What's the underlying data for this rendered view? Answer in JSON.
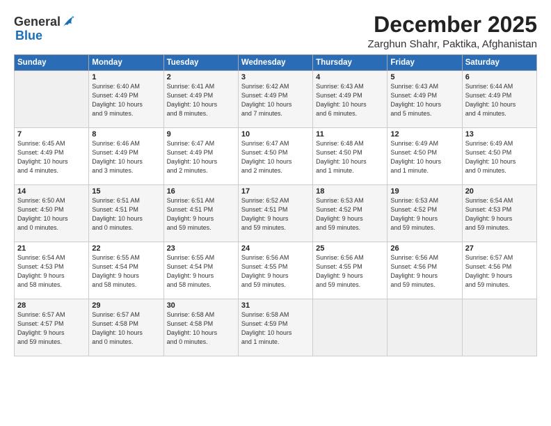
{
  "header": {
    "logo_general": "General",
    "logo_blue": "Blue",
    "title": "December 2025",
    "subtitle": "Zarghun Shahr, Paktika, Afghanistan"
  },
  "columns": [
    "Sunday",
    "Monday",
    "Tuesday",
    "Wednesday",
    "Thursday",
    "Friday",
    "Saturday"
  ],
  "rows": [
    [
      {
        "day": "",
        "info": ""
      },
      {
        "day": "1",
        "info": "Sunrise: 6:40 AM\nSunset: 4:49 PM\nDaylight: 10 hours\nand 9 minutes."
      },
      {
        "day": "2",
        "info": "Sunrise: 6:41 AM\nSunset: 4:49 PM\nDaylight: 10 hours\nand 8 minutes."
      },
      {
        "day": "3",
        "info": "Sunrise: 6:42 AM\nSunset: 4:49 PM\nDaylight: 10 hours\nand 7 minutes."
      },
      {
        "day": "4",
        "info": "Sunrise: 6:43 AM\nSunset: 4:49 PM\nDaylight: 10 hours\nand 6 minutes."
      },
      {
        "day": "5",
        "info": "Sunrise: 6:43 AM\nSunset: 4:49 PM\nDaylight: 10 hours\nand 5 minutes."
      },
      {
        "day": "6",
        "info": "Sunrise: 6:44 AM\nSunset: 4:49 PM\nDaylight: 10 hours\nand 4 minutes."
      }
    ],
    [
      {
        "day": "7",
        "info": "Sunrise: 6:45 AM\nSunset: 4:49 PM\nDaylight: 10 hours\nand 4 minutes."
      },
      {
        "day": "8",
        "info": "Sunrise: 6:46 AM\nSunset: 4:49 PM\nDaylight: 10 hours\nand 3 minutes."
      },
      {
        "day": "9",
        "info": "Sunrise: 6:47 AM\nSunset: 4:49 PM\nDaylight: 10 hours\nand 2 minutes."
      },
      {
        "day": "10",
        "info": "Sunrise: 6:47 AM\nSunset: 4:50 PM\nDaylight: 10 hours\nand 2 minutes."
      },
      {
        "day": "11",
        "info": "Sunrise: 6:48 AM\nSunset: 4:50 PM\nDaylight: 10 hours\nand 1 minute."
      },
      {
        "day": "12",
        "info": "Sunrise: 6:49 AM\nSunset: 4:50 PM\nDaylight: 10 hours\nand 1 minute."
      },
      {
        "day": "13",
        "info": "Sunrise: 6:49 AM\nSunset: 4:50 PM\nDaylight: 10 hours\nand 0 minutes."
      }
    ],
    [
      {
        "day": "14",
        "info": "Sunrise: 6:50 AM\nSunset: 4:50 PM\nDaylight: 10 hours\nand 0 minutes."
      },
      {
        "day": "15",
        "info": "Sunrise: 6:51 AM\nSunset: 4:51 PM\nDaylight: 10 hours\nand 0 minutes."
      },
      {
        "day": "16",
        "info": "Sunrise: 6:51 AM\nSunset: 4:51 PM\nDaylight: 9 hours\nand 59 minutes."
      },
      {
        "day": "17",
        "info": "Sunrise: 6:52 AM\nSunset: 4:51 PM\nDaylight: 9 hours\nand 59 minutes."
      },
      {
        "day": "18",
        "info": "Sunrise: 6:53 AM\nSunset: 4:52 PM\nDaylight: 9 hours\nand 59 minutes."
      },
      {
        "day": "19",
        "info": "Sunrise: 6:53 AM\nSunset: 4:52 PM\nDaylight: 9 hours\nand 59 minutes."
      },
      {
        "day": "20",
        "info": "Sunrise: 6:54 AM\nSunset: 4:53 PM\nDaylight: 9 hours\nand 59 minutes."
      }
    ],
    [
      {
        "day": "21",
        "info": "Sunrise: 6:54 AM\nSunset: 4:53 PM\nDaylight: 9 hours\nand 58 minutes."
      },
      {
        "day": "22",
        "info": "Sunrise: 6:55 AM\nSunset: 4:54 PM\nDaylight: 9 hours\nand 58 minutes."
      },
      {
        "day": "23",
        "info": "Sunrise: 6:55 AM\nSunset: 4:54 PM\nDaylight: 9 hours\nand 58 minutes."
      },
      {
        "day": "24",
        "info": "Sunrise: 6:56 AM\nSunset: 4:55 PM\nDaylight: 9 hours\nand 59 minutes."
      },
      {
        "day": "25",
        "info": "Sunrise: 6:56 AM\nSunset: 4:55 PM\nDaylight: 9 hours\nand 59 minutes."
      },
      {
        "day": "26",
        "info": "Sunrise: 6:56 AM\nSunset: 4:56 PM\nDaylight: 9 hours\nand 59 minutes."
      },
      {
        "day": "27",
        "info": "Sunrise: 6:57 AM\nSunset: 4:56 PM\nDaylight: 9 hours\nand 59 minutes."
      }
    ],
    [
      {
        "day": "28",
        "info": "Sunrise: 6:57 AM\nSunset: 4:57 PM\nDaylight: 9 hours\nand 59 minutes."
      },
      {
        "day": "29",
        "info": "Sunrise: 6:57 AM\nSunset: 4:58 PM\nDaylight: 10 hours\nand 0 minutes."
      },
      {
        "day": "30",
        "info": "Sunrise: 6:58 AM\nSunset: 4:58 PM\nDaylight: 10 hours\nand 0 minutes."
      },
      {
        "day": "31",
        "info": "Sunrise: 6:58 AM\nSunset: 4:59 PM\nDaylight: 10 hours\nand 1 minute."
      },
      {
        "day": "",
        "info": ""
      },
      {
        "day": "",
        "info": ""
      },
      {
        "day": "",
        "info": ""
      }
    ]
  ]
}
